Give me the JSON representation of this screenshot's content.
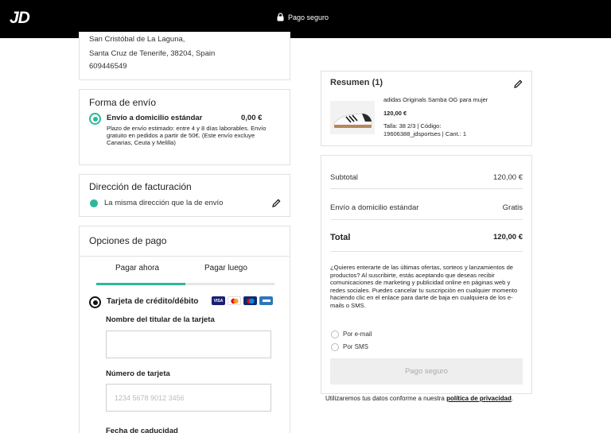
{
  "header": {
    "logo": "JD",
    "secure_label": "Pago seguro"
  },
  "address": {
    "line1": "San Cristóbal de La Laguna,",
    "line2": "Santa Cruz de Tenerife, 38204, Spain",
    "phone": "609446549"
  },
  "shipping": {
    "title": "Forma de envío",
    "option_name": "Envío a domicilio estándar",
    "option_price": "0,00 €",
    "option_desc": "Plazo de envío estimado: entre 4 y 8 días laborables. Envío gratuito en pedidos a partir de 50€. (Este envío excluye Canarias, Ceuta y Melilla)"
  },
  "billing": {
    "title": "Dirección de facturación",
    "same_address": "La misma dirección que la de envío"
  },
  "payment": {
    "title": "Opciones de pago",
    "tabs": [
      "Pagar ahora",
      "Pagar luego"
    ],
    "method_label": "Tarjeta de crédito/débito",
    "cardholder_label": "Nombre del titular de la tarjeta",
    "cardholder_value": "",
    "card_number_label": "Número de tarjeta",
    "card_number_placeholder": "1234 5678 9012 3456",
    "expiry_label": "Fecha de caducidad",
    "card_brands": [
      "VISA",
      "mastercard",
      "maestro",
      "amex"
    ]
  },
  "summary": {
    "title": "Resumen (1)",
    "product_name": "adidas Originals Samba OG para mujer",
    "product_price": "120,00 €",
    "product_details": "Talla: 38 2/3 | Código: 19606388_jdsportses | Cant.: 1"
  },
  "totals": {
    "subtotal_label": "Subtotal",
    "subtotal_value": "120,00 €",
    "shipping_label": "Envío a domicilio estándar",
    "shipping_value": "Gratis",
    "total_label": "Total",
    "total_value": "120,00 €",
    "promo_text": "¿Quieres enterarte de las últimas ofertas, sorteos y lanzamientos de productos? Al suscribirte, estás aceptando que deseas recibir comunicaciones de marketing y publicidad online en páginas web y redes sociales. Puedes cancelar tu suscripción en cualquier momento haciendo clic en el enlace para darte de baja en cualquiera de los e-mails o SMS.",
    "opt_email": "Por e-mail",
    "opt_sms": "Por SMS",
    "pay_button": "Pago seguro"
  },
  "privacy": {
    "text": "Utilizaremos tus datos conforme a nuestra",
    "link": "política de privacidad",
    "end": "."
  },
  "colors": {
    "accent": "#2bb89b",
    "header_bg": "#000000"
  }
}
